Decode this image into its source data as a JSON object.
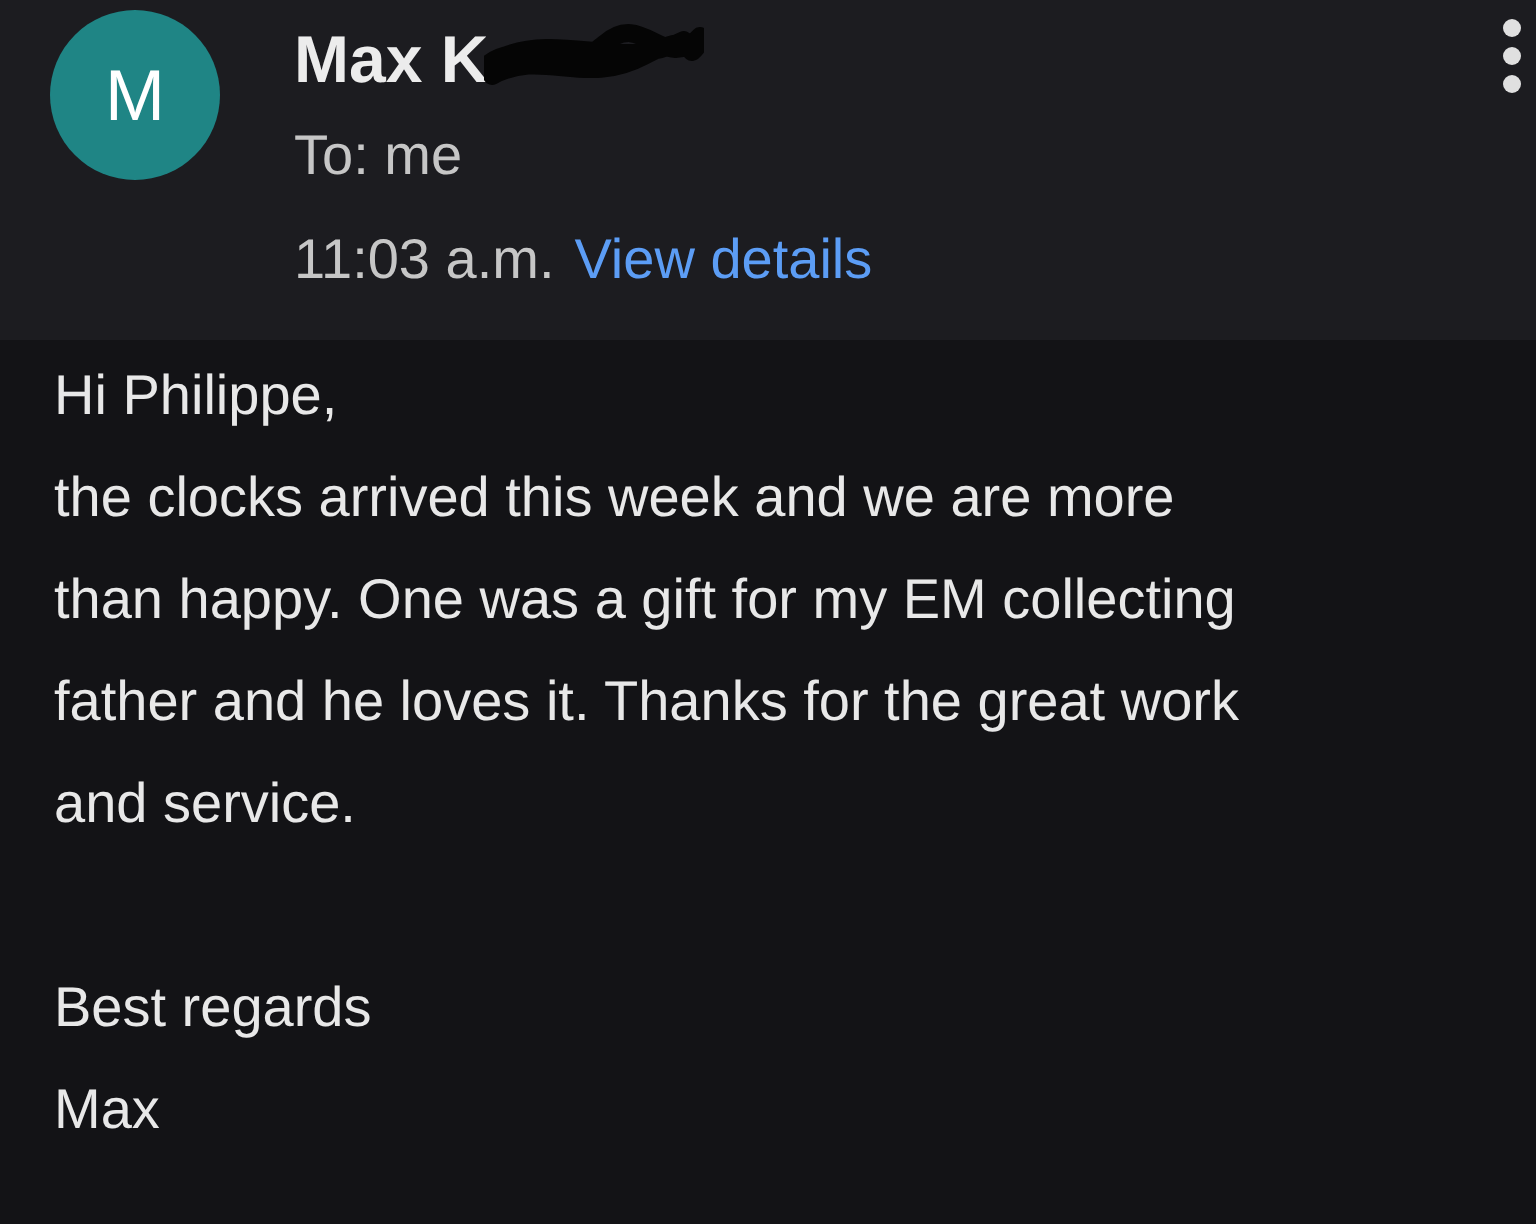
{
  "header": {
    "avatar_letter": "M",
    "sender": "Max K",
    "recipient": "To: me",
    "time": "11:03 a.m.",
    "details_link": "View details"
  },
  "body": {
    "lines": [
      "Hi Philippe,",
      "the clocks arrived this week and we are more",
      "than happy. One was a gift for my EM collecting",
      "father and he loves it. Thanks for the great work",
      "and service."
    ],
    "closing_lines": [
      "Best regards",
      "Max"
    ]
  }
}
